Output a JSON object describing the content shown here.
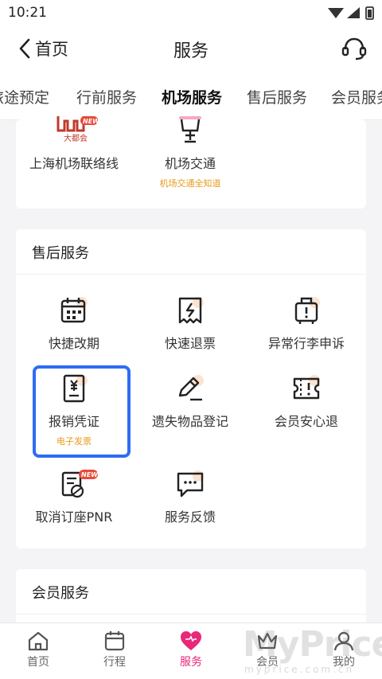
{
  "status_bar": {
    "time": "10:21"
  },
  "header": {
    "back_label": "首页",
    "title": "服务"
  },
  "tabs": [
    {
      "label": "旅途预定"
    },
    {
      "label": "行前服务"
    },
    {
      "label": "机场服务"
    },
    {
      "label": "售后服务"
    },
    {
      "label": "会员服务"
    }
  ],
  "active_tab": "机场服务",
  "airport_section": {
    "items": [
      {
        "label": "上海机场联络线",
        "badge": "NEW",
        "logo_text": "大都会"
      },
      {
        "label": "机场交通",
        "sub": "机场交通全知道"
      }
    ]
  },
  "aftersales_section": {
    "title": "售后服务",
    "items": [
      {
        "label": "快捷改期",
        "icon": "calendar-icon"
      },
      {
        "label": "快速退票",
        "icon": "refund-ticket-icon"
      },
      {
        "label": "异常行李申诉",
        "icon": "luggage-icon"
      },
      {
        "label": "报销凭证",
        "sub": "电子发票",
        "icon": "receipt-icon"
      },
      {
        "label": "遗失物品登记",
        "icon": "pen-icon"
      },
      {
        "label": "会员安心退",
        "icon": "ticket-alert-icon"
      },
      {
        "label": "取消订座PNR",
        "badge": "NEW",
        "icon": "cancel-seat-icon"
      },
      {
        "label": "服务反馈",
        "icon": "chat-icon"
      }
    ]
  },
  "member_section": {
    "title": "会员服务"
  },
  "bottom_nav": [
    {
      "label": "首页",
      "icon": "home-icon"
    },
    {
      "label": "行程",
      "icon": "calendar-icon"
    },
    {
      "label": "服务",
      "icon": "heart-icon"
    },
    {
      "label": "会员",
      "icon": "crown-icon"
    },
    {
      "label": "我的",
      "icon": "user-icon"
    }
  ],
  "watermark": {
    "text": "MyPrice",
    "sub": "myprice.com.cn"
  },
  "colors": {
    "accent_pink": "#e8287a",
    "highlight_blue": "#2e6cf6",
    "sub_orange": "#e89a1a",
    "icon_peach": "#fbe3cf"
  }
}
